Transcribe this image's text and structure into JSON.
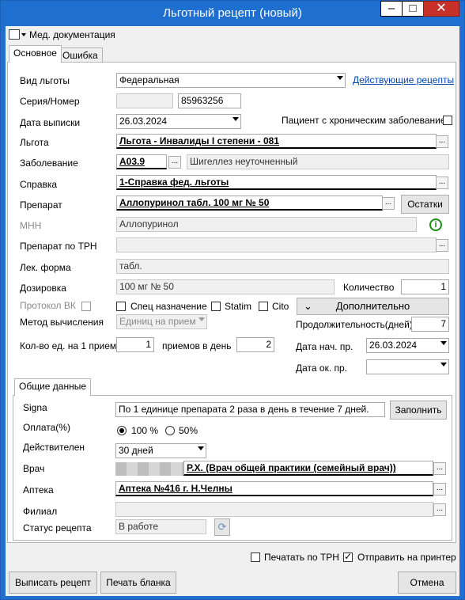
{
  "window": {
    "title": "Льготный рецепт (новый)",
    "minimize": "‒",
    "maximize": "□",
    "close": "✕"
  },
  "menu": {
    "docs_label": "Мед. документация"
  },
  "tabs": [
    "Основное",
    "Ошибка"
  ],
  "form": {
    "benefit_type": {
      "label": "Вид льготы",
      "value": "Федеральная",
      "link": "Действующие рецепты"
    },
    "series_number": {
      "label": "Серия/Номер",
      "series": "",
      "number": "85963256"
    },
    "issue_date": {
      "label": "Дата выписки",
      "value": "26.03.2024"
    },
    "chronic": {
      "label": "Пациент с хроническим заболеванием",
      "checked": false
    },
    "benefit": {
      "label": "Льгота",
      "value": "Льгота - Инвалиды I степени - 081"
    },
    "disease": {
      "label": "Заболевание",
      "code": "A03.9",
      "name": "Шигеллез неуточненный"
    },
    "certificate": {
      "label": "Справка",
      "value": "1-Справка фед. льготы"
    },
    "drug": {
      "label": "Препарат",
      "value": "Аллопуринол табл. 100 мг № 50",
      "rest_button": "Остатки"
    },
    "inn": {
      "label": "МНН",
      "value": "Аллопуринол"
    },
    "drug_trn": {
      "label": "Препарат по ТРН",
      "value": ""
    },
    "form_type": {
      "label": "Лек. форма",
      "value": "табл."
    },
    "dosage": {
      "label": "Дозировка",
      "value": "100 мг № 50",
      "qty_label": "Количество",
      "qty": "1"
    },
    "protocol": {
      "label": "Протокол ВК"
    },
    "special": "Спец назначение",
    "statim": "Statim",
    "cito": "Cito",
    "more_button": "Дополнительно",
    "calc_method": {
      "label": "Метод вычисления",
      "value": "Единиц на прием"
    },
    "duration": {
      "label": "Продолжительность(дней)",
      "value": "7"
    },
    "per_dose": {
      "label": "Кол-во ед. на 1 прием",
      "value": "1",
      "times_label": "приемов в день",
      "times": "2"
    },
    "start_date": {
      "label": "Дата нач. пр.",
      "value": "26.03.2024"
    },
    "end_date": {
      "label": "Дата ок. пр.",
      "value": ""
    }
  },
  "general": {
    "tab": "Общие данные",
    "signa": {
      "label": "Signa",
      "value": "По 1 единице препарата 2 раза в день в течение 7 дней.",
      "fill_button": "Заполнить"
    },
    "payment": {
      "label": "Оплата(%)",
      "opt1": "100 %",
      "opt2": "50%",
      "selected": "100 %"
    },
    "valid": {
      "label": "Действителен",
      "value": "30 дней"
    },
    "doctor": {
      "label": "Врач",
      "value": "Р.Х. (Врач общей практики (семейный врач))"
    },
    "pharmacy": {
      "label": "Аптека",
      "value": "Аптека №416 г. Н.Челны"
    },
    "branch": {
      "label": "Филиал",
      "value": ""
    },
    "status": {
      "label": "Статус рецепта",
      "value": "В работе"
    }
  },
  "bottom": {
    "print_trn": "Печатать по ТРН",
    "send_printer": "Отправить на принтер",
    "issue_button": "Выписать рецепт",
    "print_button": "Печать бланка",
    "cancel_button": "Отмена"
  }
}
